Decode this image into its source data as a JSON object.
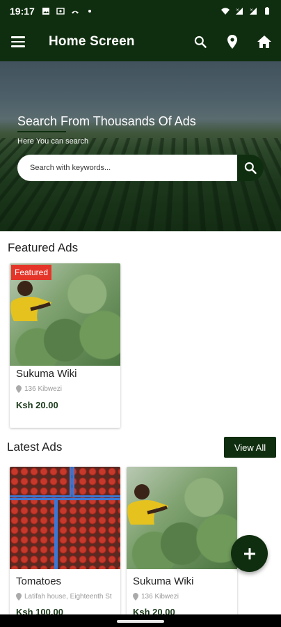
{
  "status_bar": {
    "time": "19:17",
    "left_icons": [
      "image-icon",
      "cast-icon",
      "missed-call-icon",
      "dot-icon"
    ],
    "right_icons": [
      "wifi-icon",
      "signal-icon",
      "signal-icon",
      "battery-icon"
    ]
  },
  "app_bar": {
    "title": "Home Screen",
    "actions": [
      "search-icon",
      "location-pin-icon",
      "home-icon"
    ]
  },
  "hero": {
    "title": "Search From Thousands Of Ads",
    "subtitle": "Here You can search",
    "search_placeholder": "Search with keywords..."
  },
  "featured": {
    "section_title": "Featured Ads",
    "items": [
      {
        "badge": "Featured",
        "name": "Sukuma Wiki",
        "location": "136 Kibwezi",
        "price": "Ksh 20.00",
        "image": "kale"
      }
    ]
  },
  "latest": {
    "section_title": "Latest Ads",
    "view_all_label": "View All",
    "items": [
      {
        "name": "Tomatoes",
        "location": "Latifah house, Eighteenth St",
        "price": "Ksh 100.00",
        "image": "tomatoes"
      },
      {
        "name": "Sukuma Wiki",
        "location": "136 Kibwezi",
        "price": "Ksh 20.00",
        "image": "kale"
      }
    ]
  },
  "fab_icon": "plus-icon",
  "colors": {
    "primary": "#0f2e0f",
    "badge": "#e53529"
  }
}
